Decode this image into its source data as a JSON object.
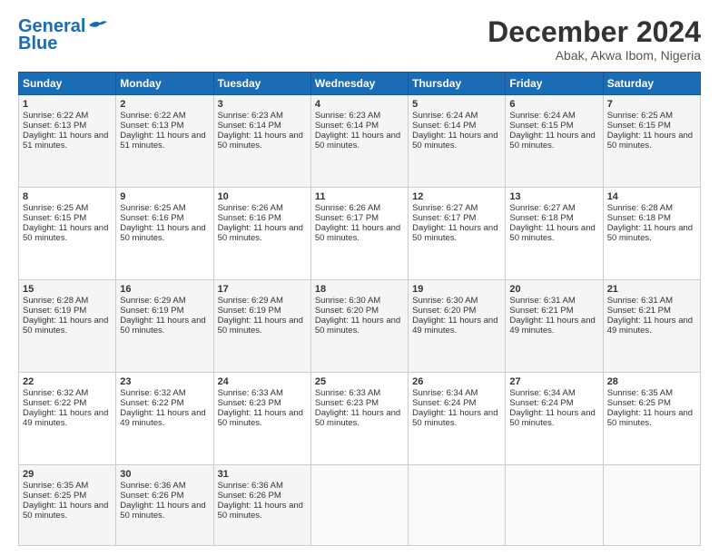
{
  "header": {
    "logo_line1": "General",
    "logo_line2": "Blue",
    "month": "December 2024",
    "location": "Abak, Akwa Ibom, Nigeria"
  },
  "days": [
    "Sunday",
    "Monday",
    "Tuesday",
    "Wednesday",
    "Thursday",
    "Friday",
    "Saturday"
  ],
  "weeks": [
    [
      {
        "day": 1,
        "sunrise": "6:22 AM",
        "sunset": "6:13 PM",
        "daylight": "11 hours and 51 minutes"
      },
      {
        "day": 2,
        "sunrise": "6:22 AM",
        "sunset": "6:13 PM",
        "daylight": "11 hours and 51 minutes"
      },
      {
        "day": 3,
        "sunrise": "6:23 AM",
        "sunset": "6:14 PM",
        "daylight": "11 hours and 50 minutes"
      },
      {
        "day": 4,
        "sunrise": "6:23 AM",
        "sunset": "6:14 PM",
        "daylight": "11 hours and 50 minutes"
      },
      {
        "day": 5,
        "sunrise": "6:24 AM",
        "sunset": "6:14 PM",
        "daylight": "11 hours and 50 minutes"
      },
      {
        "day": 6,
        "sunrise": "6:24 AM",
        "sunset": "6:15 PM",
        "daylight": "11 hours and 50 minutes"
      },
      {
        "day": 7,
        "sunrise": "6:25 AM",
        "sunset": "6:15 PM",
        "daylight": "11 hours and 50 minutes"
      }
    ],
    [
      {
        "day": 8,
        "sunrise": "6:25 AM",
        "sunset": "6:15 PM",
        "daylight": "11 hours and 50 minutes"
      },
      {
        "day": 9,
        "sunrise": "6:25 AM",
        "sunset": "6:16 PM",
        "daylight": "11 hours and 50 minutes"
      },
      {
        "day": 10,
        "sunrise": "6:26 AM",
        "sunset": "6:16 PM",
        "daylight": "11 hours and 50 minutes"
      },
      {
        "day": 11,
        "sunrise": "6:26 AM",
        "sunset": "6:17 PM",
        "daylight": "11 hours and 50 minutes"
      },
      {
        "day": 12,
        "sunrise": "6:27 AM",
        "sunset": "6:17 PM",
        "daylight": "11 hours and 50 minutes"
      },
      {
        "day": 13,
        "sunrise": "6:27 AM",
        "sunset": "6:18 PM",
        "daylight": "11 hours and 50 minutes"
      },
      {
        "day": 14,
        "sunrise": "6:28 AM",
        "sunset": "6:18 PM",
        "daylight": "11 hours and 50 minutes"
      }
    ],
    [
      {
        "day": 15,
        "sunrise": "6:28 AM",
        "sunset": "6:19 PM",
        "daylight": "11 hours and 50 minutes"
      },
      {
        "day": 16,
        "sunrise": "6:29 AM",
        "sunset": "6:19 PM",
        "daylight": "11 hours and 50 minutes"
      },
      {
        "day": 17,
        "sunrise": "6:29 AM",
        "sunset": "6:19 PM",
        "daylight": "11 hours and 50 minutes"
      },
      {
        "day": 18,
        "sunrise": "6:30 AM",
        "sunset": "6:20 PM",
        "daylight": "11 hours and 50 minutes"
      },
      {
        "day": 19,
        "sunrise": "6:30 AM",
        "sunset": "6:20 PM",
        "daylight": "11 hours and 49 minutes"
      },
      {
        "day": 20,
        "sunrise": "6:31 AM",
        "sunset": "6:21 PM",
        "daylight": "11 hours and 49 minutes"
      },
      {
        "day": 21,
        "sunrise": "6:31 AM",
        "sunset": "6:21 PM",
        "daylight": "11 hours and 49 minutes"
      }
    ],
    [
      {
        "day": 22,
        "sunrise": "6:32 AM",
        "sunset": "6:22 PM",
        "daylight": "11 hours and 49 minutes"
      },
      {
        "day": 23,
        "sunrise": "6:32 AM",
        "sunset": "6:22 PM",
        "daylight": "11 hours and 49 minutes"
      },
      {
        "day": 24,
        "sunrise": "6:33 AM",
        "sunset": "6:23 PM",
        "daylight": "11 hours and 50 minutes"
      },
      {
        "day": 25,
        "sunrise": "6:33 AM",
        "sunset": "6:23 PM",
        "daylight": "11 hours and 50 minutes"
      },
      {
        "day": 26,
        "sunrise": "6:34 AM",
        "sunset": "6:24 PM",
        "daylight": "11 hours and 50 minutes"
      },
      {
        "day": 27,
        "sunrise": "6:34 AM",
        "sunset": "6:24 PM",
        "daylight": "11 hours and 50 minutes"
      },
      {
        "day": 28,
        "sunrise": "6:35 AM",
        "sunset": "6:25 PM",
        "daylight": "11 hours and 50 minutes"
      }
    ],
    [
      {
        "day": 29,
        "sunrise": "6:35 AM",
        "sunset": "6:25 PM",
        "daylight": "11 hours and 50 minutes"
      },
      {
        "day": 30,
        "sunrise": "6:36 AM",
        "sunset": "6:26 PM",
        "daylight": "11 hours and 50 minutes"
      },
      {
        "day": 31,
        "sunrise": "6:36 AM",
        "sunset": "6:26 PM",
        "daylight": "11 hours and 50 minutes"
      },
      null,
      null,
      null,
      null
    ]
  ]
}
